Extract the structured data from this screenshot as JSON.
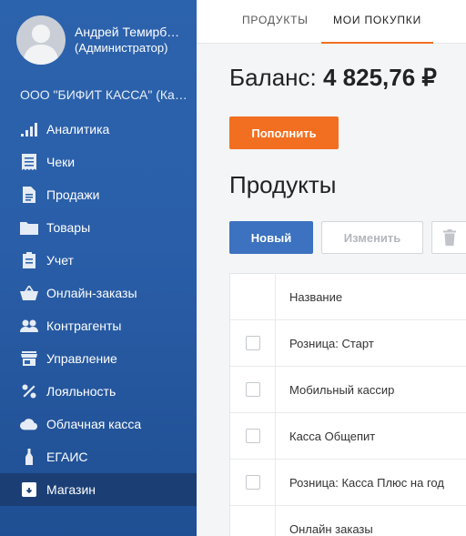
{
  "user": {
    "name": "Андрей Темирбекович",
    "role": "(Администратор)"
  },
  "organization": "ООО \"БИФИТ КАССА\" (Касса)",
  "sidebar": {
    "items": [
      {
        "label": "Аналитика",
        "icon": "analytics-icon"
      },
      {
        "label": "Чеки",
        "icon": "receipt-icon"
      },
      {
        "label": "Продажи",
        "icon": "document-icon"
      },
      {
        "label": "Товары",
        "icon": "folder-icon"
      },
      {
        "label": "Учет",
        "icon": "clipboard-icon"
      },
      {
        "label": "Онлайн-заказы",
        "icon": "basket-icon"
      },
      {
        "label": "Контрагенты",
        "icon": "people-icon"
      },
      {
        "label": "Управление",
        "icon": "store-icon"
      },
      {
        "label": "Лояльность",
        "icon": "percent-icon"
      },
      {
        "label": "Облачная касса",
        "icon": "cloud-icon"
      },
      {
        "label": "ЕГАИС",
        "icon": "bottle-icon"
      },
      {
        "label": "Магазин",
        "icon": "shop-box-icon",
        "active": true
      }
    ]
  },
  "tabs": [
    {
      "label": "ПРОДУКТЫ"
    },
    {
      "label": "МОИ ПОКУПКИ",
      "active": true
    }
  ],
  "balance": {
    "label": "Баланс:",
    "value": "4 825,76 ₽"
  },
  "buttons": {
    "topup": "Пополнить",
    "new": "Новый",
    "edit": "Изменить"
  },
  "section_title": "Продукты",
  "table": {
    "column_name": "Название",
    "rows": [
      "Розница: Старт",
      "Мобильный кассир",
      "Касса Общепит",
      "Розница: Касса Плюс на год",
      "Онлайн заказы"
    ]
  },
  "colors": {
    "sidebar": "#2c63ad",
    "sidebar_active": "#1b3f75",
    "accent_orange": "#f26f21",
    "primary_blue": "#3c72bf"
  }
}
